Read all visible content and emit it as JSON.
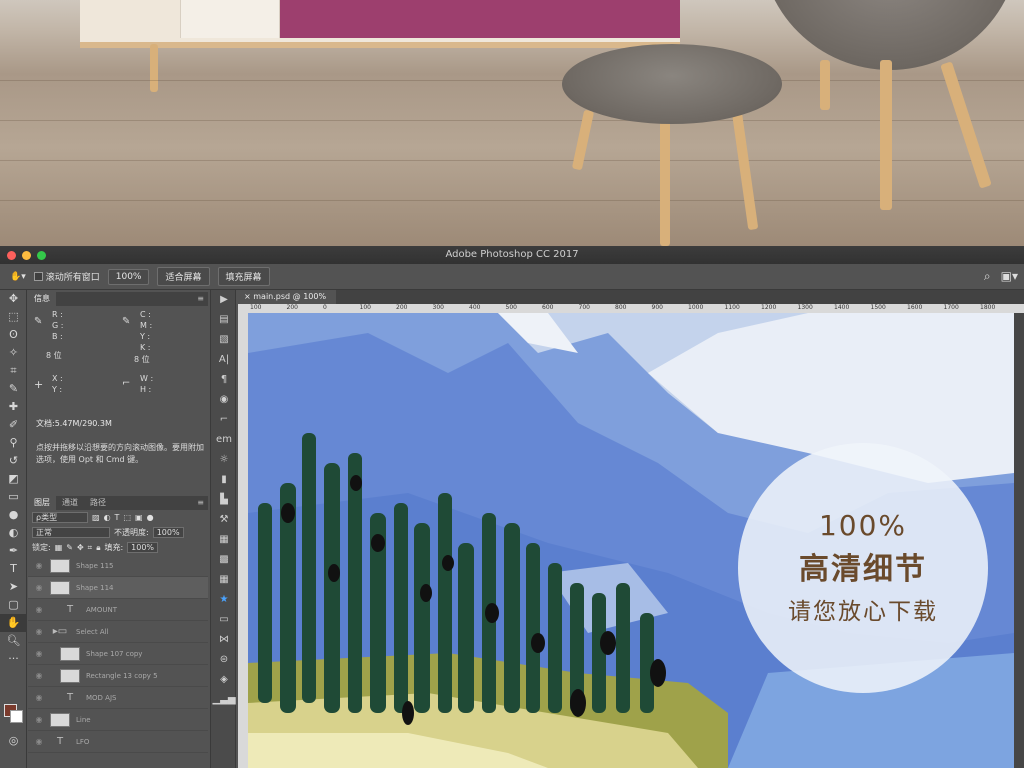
{
  "window": {
    "title": "Adobe Photoshop CC 2017"
  },
  "options_bar": {
    "scroll_all_label": "滚动所有窗口",
    "zoom_100_label": "100%",
    "fit_screen_label": "适合屏幕",
    "fill_screen_label": "填充屏幕"
  },
  "info_panel": {
    "tab": "信息",
    "rgb": {
      "r": "R :",
      "g": "G :",
      "b": "B :"
    },
    "cmyk": {
      "c": "C :",
      "m": "M :",
      "y": "Y :",
      "k": "K :"
    },
    "bit_left": "8 位",
    "bit_right": "8 位",
    "xy": {
      "x": "X :",
      "y": "Y :"
    },
    "wh": {
      "w": "W :",
      "h": "H :"
    },
    "doc_size": "文档:5.47M/290.3M",
    "hint": "点按并拖移以沿想要的方向滚动图像。要用附加选项，使用 Opt 和 Cmd 键。"
  },
  "layers_panel": {
    "tabs": [
      "图层",
      "通道",
      "路径"
    ],
    "filter_kind": "ρ类型",
    "blend_mode": "正常",
    "opacity_label": "不透明度:",
    "opacity_value": "100%",
    "lock_label": "锁定:",
    "fill_label": "填充:",
    "fill_value": "100%",
    "layers": [
      {
        "name": "Shape 115",
        "kind": "shape",
        "indent": false,
        "selected": false
      },
      {
        "name": "Shape 114",
        "kind": "shape",
        "indent": false,
        "selected": true
      },
      {
        "name": "AMOUNT",
        "kind": "text",
        "indent": true,
        "selected": false
      },
      {
        "name": "Select All",
        "kind": "group",
        "indent": false,
        "selected": false
      },
      {
        "name": "Shape 107 copy",
        "kind": "shape",
        "indent": true,
        "selected": false
      },
      {
        "name": "Rectangle 13 copy 5",
        "kind": "shape",
        "indent": true,
        "selected": false
      },
      {
        "name": "MOD AJS",
        "kind": "text",
        "indent": true,
        "selected": false
      },
      {
        "name": "Line",
        "kind": "shape",
        "indent": false,
        "selected": false
      },
      {
        "name": "LFO",
        "kind": "text",
        "indent": false,
        "selected": false
      }
    ]
  },
  "document": {
    "tab_label": "main.psd @ 100%",
    "ruler_ticks": [
      "100",
      "200",
      "0",
      "100",
      "200",
      "300",
      "400",
      "500",
      "600",
      "700",
      "800",
      "900",
      "1000",
      "1100",
      "1200",
      "1300",
      "1400",
      "1500",
      "1600",
      "1700",
      "1800"
    ]
  },
  "artwork": {
    "percent": "100%",
    "headline": "高清细节",
    "subline": "请您放心下载"
  },
  "colors": {
    "ps_panel": "#535353",
    "badge_text": "#6a4a2c",
    "foreground_swatch": "#7a3a2c",
    "background_swatch": "#ffffff"
  }
}
